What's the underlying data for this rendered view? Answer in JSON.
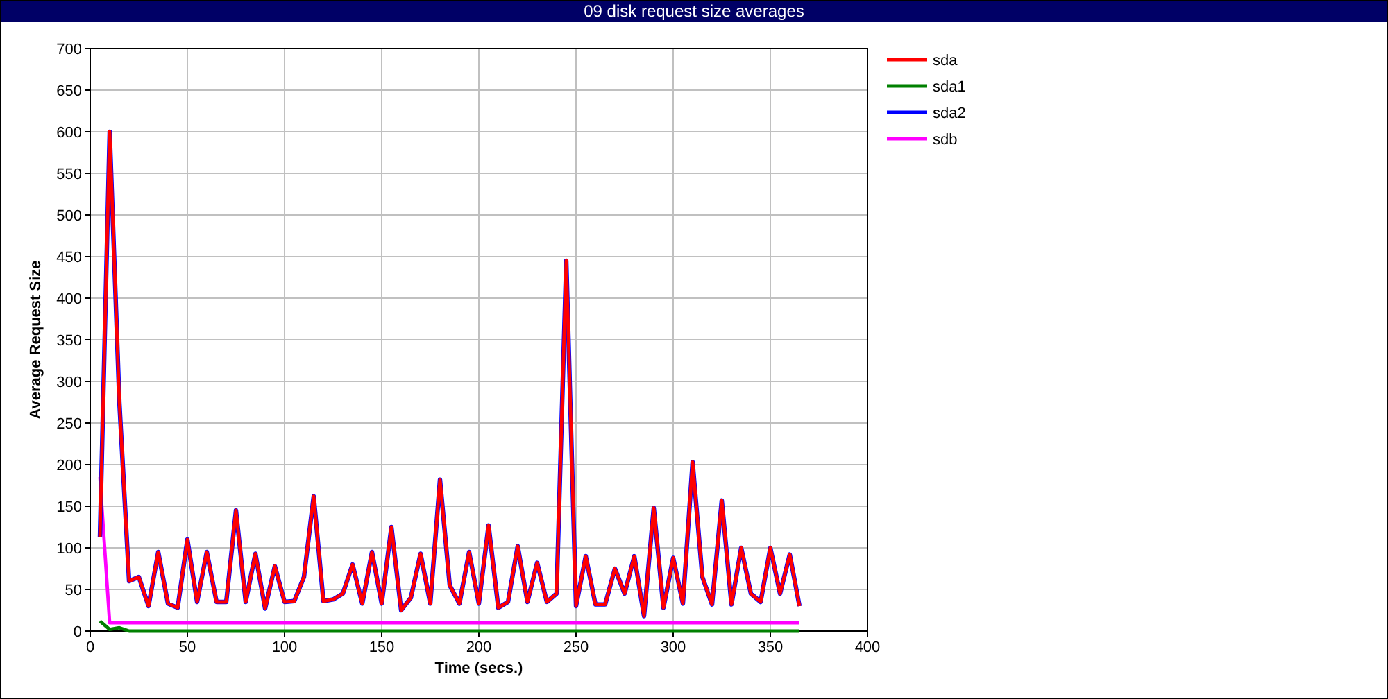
{
  "window": {
    "title": "09 disk request size averages"
  },
  "chart_data": {
    "type": "line",
    "xlabel": "Time (secs.)",
    "ylabel": "Average Request Size",
    "x": [
      5,
      10,
      15,
      20,
      25,
      30,
      35,
      40,
      45,
      50,
      55,
      60,
      65,
      70,
      75,
      80,
      85,
      90,
      95,
      100,
      105,
      110,
      115,
      120,
      125,
      130,
      135,
      140,
      145,
      150,
      155,
      160,
      165,
      170,
      175,
      180,
      185,
      190,
      195,
      200,
      205,
      210,
      215,
      220,
      225,
      230,
      235,
      240,
      245,
      250,
      255,
      260,
      265,
      270,
      275,
      280,
      285,
      290,
      295,
      300,
      305,
      310,
      315,
      320,
      325,
      330,
      335,
      340,
      345,
      350,
      355,
      360,
      365
    ],
    "series": [
      {
        "name": "sda",
        "color": "#ff0000",
        "values": [
          113,
          600,
          275,
          60,
          65,
          30,
          95,
          33,
          28,
          110,
          35,
          95,
          35,
          35,
          145,
          35,
          93,
          27,
          78,
          35,
          36,
          65,
          162,
          36,
          38,
          45,
          80,
          33,
          95,
          33,
          125,
          25,
          40,
          93,
          33,
          182,
          55,
          33,
          95,
          33,
          127,
          28,
          35,
          102,
          35,
          82,
          35,
          45,
          445,
          30,
          90,
          32,
          32,
          75,
          45,
          90,
          18,
          148,
          28,
          88,
          33,
          203,
          65,
          32,
          157,
          32,
          100,
          45,
          35,
          100,
          45,
          92,
          30
        ]
      },
      {
        "name": "sda1",
        "color": "#008000",
        "values": [
          12,
          2,
          4,
          0,
          0,
          0,
          0,
          0,
          0,
          0,
          0,
          0,
          0,
          0,
          0,
          0,
          0,
          0,
          0,
          0,
          0,
          0,
          0,
          0,
          0,
          0,
          0,
          0,
          0,
          0,
          0,
          0,
          0,
          0,
          0,
          0,
          0,
          0,
          0,
          0,
          0,
          0,
          0,
          0,
          0,
          0,
          0,
          0,
          0,
          0,
          0,
          0,
          0,
          0,
          0,
          0,
          0,
          0,
          0,
          0,
          0,
          0,
          0,
          0,
          0,
          0,
          0,
          0,
          0,
          0,
          0,
          0,
          0
        ]
      },
      {
        "name": "sda2",
        "color": "#0000ff",
        "values": [
          113,
          600,
          275,
          60,
          65,
          30,
          95,
          33,
          28,
          110,
          35,
          95,
          35,
          35,
          145,
          35,
          93,
          27,
          78,
          35,
          36,
          65,
          162,
          36,
          38,
          45,
          80,
          33,
          95,
          33,
          125,
          25,
          40,
          93,
          33,
          182,
          55,
          33,
          95,
          33,
          127,
          28,
          35,
          102,
          35,
          82,
          35,
          45,
          445,
          30,
          90,
          32,
          32,
          75,
          45,
          90,
          18,
          148,
          28,
          88,
          33,
          203,
          65,
          32,
          157,
          32,
          100,
          45,
          35,
          100,
          45,
          92,
          30
        ]
      },
      {
        "name": "sdb",
        "color": "#ff00ff",
        "values": [
          185,
          10,
          10,
          10,
          10,
          10,
          10,
          10,
          10,
          10,
          10,
          10,
          10,
          10,
          10,
          10,
          10,
          10,
          10,
          10,
          10,
          10,
          10,
          10,
          10,
          10,
          10,
          10,
          10,
          10,
          10,
          10,
          10,
          10,
          10,
          10,
          10,
          10,
          10,
          10,
          10,
          10,
          10,
          10,
          10,
          10,
          10,
          10,
          10,
          10,
          10,
          10,
          10,
          10,
          10,
          10,
          10,
          10,
          10,
          10,
          10,
          10,
          10,
          10,
          10,
          10,
          10,
          10,
          10,
          10,
          10,
          10,
          10
        ]
      }
    ],
    "grid": true,
    "legend": true,
    "xlim": [
      0,
      400
    ],
    "ylim": [
      0,
      700
    ],
    "xticks": [
      0,
      50,
      100,
      150,
      200,
      250,
      300,
      350,
      400
    ],
    "yticks": [
      0,
      50,
      100,
      150,
      200,
      250,
      300,
      350,
      400,
      450,
      500,
      550,
      600,
      650,
      700
    ]
  }
}
